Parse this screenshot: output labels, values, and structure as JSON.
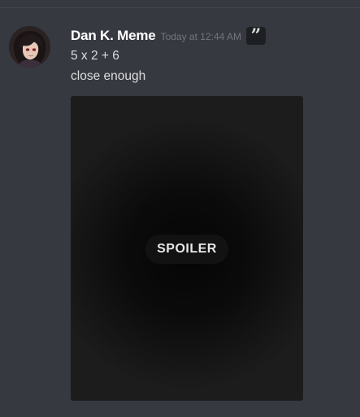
{
  "message": {
    "author": "Dan K. Meme",
    "timestamp": "Today at 12:44 AM",
    "badge_icon": "quote-icon",
    "lines": [
      "5 x 2 + 6",
      "close enough"
    ]
  },
  "attachment": {
    "spoiler_label": "SPOILER"
  },
  "colors": {
    "background": "#36393f",
    "username": "#ffffff",
    "timestamp": "#72767d",
    "text": "#dcddde"
  }
}
